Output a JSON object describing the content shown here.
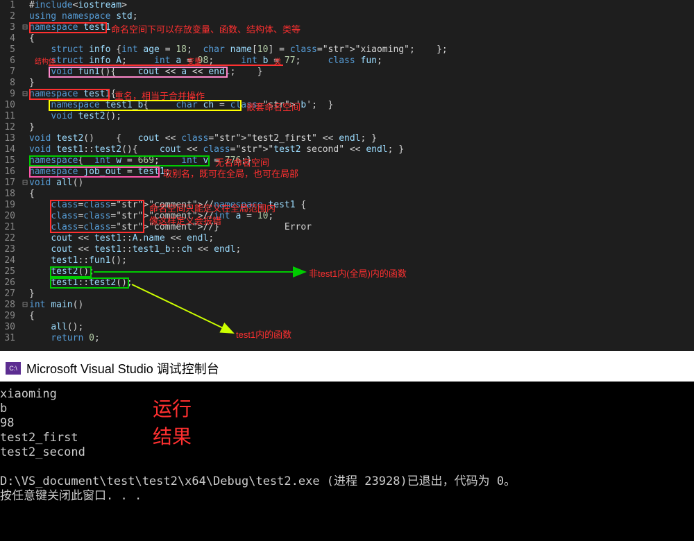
{
  "code": [
    {
      "n": "1",
      "fold": "",
      "txt": "#include<iostream>"
    },
    {
      "n": "2",
      "fold": "",
      "txt": "using namespace std;"
    },
    {
      "n": "3",
      "fold": "⊟",
      "txt": "namespace test1"
    },
    {
      "n": "4",
      "fold": "",
      "txt": "{"
    },
    {
      "n": "5",
      "fold": "",
      "txt": "    struct info {int age = 18;  char name[10] = \"xiaoming\";    };"
    },
    {
      "n": "6",
      "fold": "",
      "txt": "    struct info A;     int a = 98;     int b = 77;     class fun;"
    },
    {
      "n": "7",
      "fold": "",
      "txt": "    void fun1(){    cout << a << endl;    }"
    },
    {
      "n": "8",
      "fold": "",
      "txt": "}"
    },
    {
      "n": "9",
      "fold": "⊟",
      "txt": "namespace test1{"
    },
    {
      "n": "10",
      "fold": "",
      "txt": "    namespace test1_b{     char ch = 'b';  }"
    },
    {
      "n": "11",
      "fold": "",
      "txt": "    void test2();"
    },
    {
      "n": "12",
      "fold": "",
      "txt": "}"
    },
    {
      "n": "13",
      "fold": "",
      "txt": "void test2()    {   cout << \"test2_first\" << endl; }"
    },
    {
      "n": "14",
      "fold": "",
      "txt": "void test1::test2(){    cout << \"test2 second\" << endl; }"
    },
    {
      "n": "15",
      "fold": "",
      "txt": "namespace{  int w = 669;    int v = 776;}"
    },
    {
      "n": "16",
      "fold": "",
      "txt": "namespace job_out = test1;"
    },
    {
      "n": "17",
      "fold": "⊟",
      "txt": "void all()"
    },
    {
      "n": "18",
      "fold": "",
      "txt": "{"
    },
    {
      "n": "19",
      "fold": "",
      "txt": "    //namespace test1 {"
    },
    {
      "n": "20",
      "fold": "",
      "txt": "    //int a = 10;"
    },
    {
      "n": "21",
      "fold": "",
      "txt": "    //}            Error"
    },
    {
      "n": "22",
      "fold": "",
      "txt": "    cout << test1::A.name << endl;"
    },
    {
      "n": "23",
      "fold": "",
      "txt": "    cout << test1::test1_b::ch << endl;"
    },
    {
      "n": "24",
      "fold": "",
      "txt": "    test1::fun1();"
    },
    {
      "n": "25",
      "fold": "",
      "txt": "    test2();"
    },
    {
      "n": "26",
      "fold": "",
      "txt": "    test1::test2();"
    },
    {
      "n": "27",
      "fold": "",
      "txt": "}"
    },
    {
      "n": "28",
      "fold": "⊟",
      "txt": "int main()"
    },
    {
      "n": "29",
      "fold": "",
      "txt": "{"
    },
    {
      "n": "30",
      "fold": "",
      "txt": "    all();"
    },
    {
      "n": "31",
      "fold": "",
      "txt": "    return 0;"
    }
  ],
  "annotations": {
    "ns_explain": "命名空间下可以存放变量、函数、结构体、类等",
    "struct_prefix": "结构体",
    "var_prefix": "变量",
    "class_prefix": "类",
    "redef": "重名，相当于合并操作",
    "nested": "嵌套命名空间",
    "anon": "无名命名空间",
    "alias": "取别名，既可在全局，也可在局部",
    "only_global1": "命名空间只能定义在全局范围内",
    "only_global2": "像这样定义会报错",
    "arrow_global": "非test1内(全局)内的函数",
    "arrow_test1": "test1内的函数"
  },
  "console": {
    "title": "Microsoft Visual Studio 调试控制台",
    "icon": "C:\\",
    "out": [
      "xiaoming",
      "b",
      "98",
      "test2_first",
      "test2_second"
    ],
    "exit": "D:\\VS_document\\test\\test2\\x64\\Debug\\test2.exe (进程 23928)已退出，代码为 0。",
    "prompt": "按任意键关闭此窗口. . .",
    "note1": "运行",
    "note2": "结果"
  }
}
